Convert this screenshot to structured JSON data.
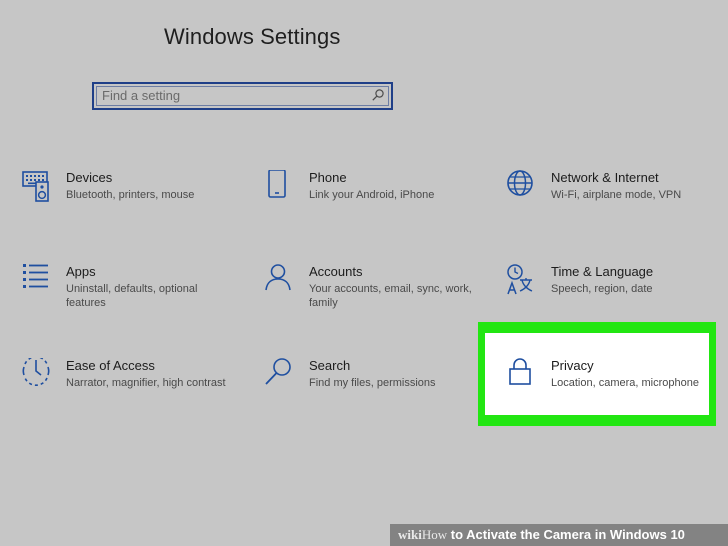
{
  "window": {
    "title": "Windows Settings"
  },
  "search": {
    "placeholder": "Find a setting",
    "icon": "search-icon"
  },
  "tiles": [
    {
      "name": "Devices",
      "desc": "Bluetooth, printers, mouse",
      "icon": "keyboard-speaker-icon"
    },
    {
      "name": "Phone",
      "desc": "Link your Android, iPhone",
      "icon": "phone-icon"
    },
    {
      "name": "Network & Internet",
      "desc": "Wi-Fi, airplane mode, VPN",
      "icon": "globe-icon"
    },
    {
      "name": "Apps",
      "desc": "Uninstall, defaults, optional features",
      "icon": "list-icon"
    },
    {
      "name": "Accounts",
      "desc": "Your accounts, email, sync, work, family",
      "icon": "person-icon"
    },
    {
      "name": "Time & Language",
      "desc": "Speech, region, date",
      "icon": "time-language-icon"
    },
    {
      "name": "Ease of Access",
      "desc": "Narrator, magnifier, high contrast",
      "icon": "ease-of-access-icon"
    },
    {
      "name": "Search",
      "desc": "Find my files, permissions",
      "icon": "search-icon"
    },
    {
      "name": "Privacy",
      "desc": "Location, camera, microphone",
      "icon": "lock-icon"
    }
  ],
  "watermark": {
    "brand_bold": "wiki",
    "brand_light": "How",
    "text": " to Activate the Camera in Windows 10"
  },
  "colors": {
    "background": "#c6c6c6",
    "icon_blue": "#1f4fa0",
    "highlight": "#22e612",
    "search_border": "#1f3f88"
  }
}
